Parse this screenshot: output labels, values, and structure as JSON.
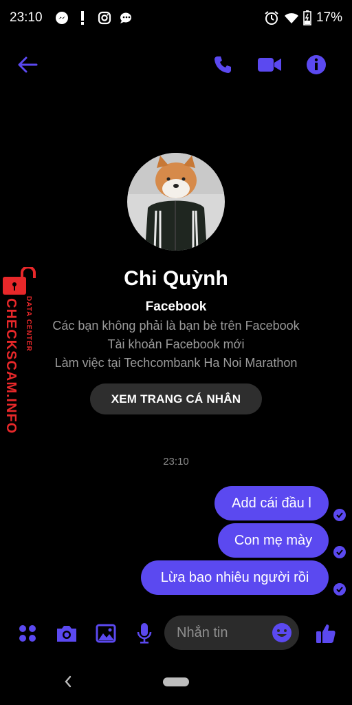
{
  "status_bar": {
    "time": "23:10",
    "battery_percent": "17%",
    "icons_left": [
      "messenger-icon",
      "alert-icon",
      "instagram-icon",
      "chat-bubble-icon"
    ],
    "icons_right": [
      "alarm-icon",
      "wifi-icon",
      "battery-icon"
    ]
  },
  "header": {
    "icons": [
      "back-arrow-icon",
      "phone-icon",
      "video-camera-icon",
      "info-icon"
    ]
  },
  "colors": {
    "accent": "#5b49f0",
    "background": "#000000",
    "secondary_text": "#9a9a9a",
    "watermark": "#e8282a"
  },
  "profile": {
    "name": "Chi Quỳnh",
    "source": "Facebook",
    "lines": [
      "Các bạn không phải là bạn bè trên Facebook",
      "Tài khoản Facebook mới",
      "Làm việc tại Techcombank Ha Noi Marathon"
    ],
    "view_profile_label": "XEM TRANG CÁ NHÂN"
  },
  "conversation": {
    "timestamp": "23:10",
    "messages": [
      {
        "text": "Add cái đầu l",
        "sender": "me",
        "status": "seen"
      },
      {
        "text": "Con mẹ mày",
        "sender": "me",
        "status": "seen"
      },
      {
        "text": "Lừa bao nhiêu người rồi",
        "sender": "me",
        "status": "seen"
      }
    ]
  },
  "composer": {
    "placeholder": "Nhắn tin",
    "icons": [
      "menu-dots-icon",
      "camera-icon",
      "image-icon",
      "microphone-icon",
      "emoji-icon",
      "thumbs-up-icon"
    ]
  },
  "watermark": {
    "small_text": "DATA CENTER",
    "big_text": "CHECKSCAM.INFO"
  }
}
